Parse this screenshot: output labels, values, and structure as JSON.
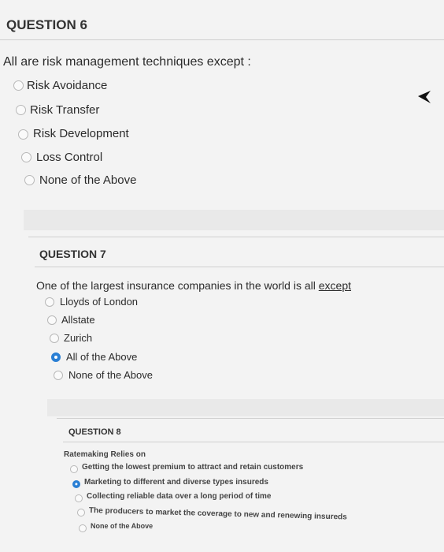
{
  "q6": {
    "title": "QUESTION 6",
    "prompt": "All are risk management techniques except :",
    "options": [
      "Risk Avoidance",
      "Risk Transfer",
      "Risk Development",
      "Loss Control",
      "None of the Above"
    ]
  },
  "q7": {
    "title": "QUESTION 7",
    "prompt_main": "One of the largest insurance companies in the world is all ",
    "prompt_emph": "except",
    "options": [
      "Lloyds of London",
      "Allstate",
      "Zurich",
      "All of the Above",
      "None of the Above"
    ],
    "selected": "All of the Above"
  },
  "q8": {
    "title": "QUESTION 8",
    "prompt": "Ratemaking Relies on",
    "options": [
      "Getting the lowest premium to attract and retain customers",
      "Marketing to different and diverse types insureds",
      "Collecting reliable data over a long period of time",
      "The producers to market the coverage to new and renewing insureds",
      "None of the Above"
    ],
    "selected": "Marketing to different and diverse types insureds"
  },
  "colors": {
    "accent": "#2a7fd4",
    "background": "#f3f3f3"
  },
  "icons": {
    "cursor": "mouse-pointer-icon"
  }
}
